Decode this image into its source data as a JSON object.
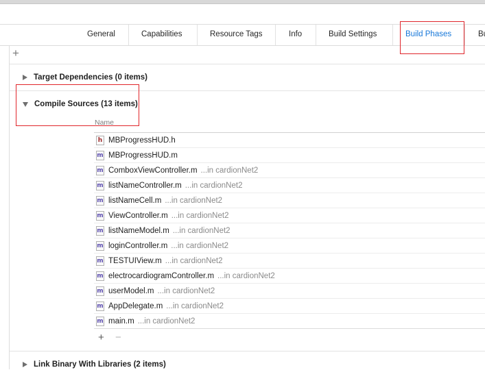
{
  "tabs": [
    {
      "label": "General",
      "active": false
    },
    {
      "label": "Capabilities",
      "active": false
    },
    {
      "label": "Resource Tags",
      "active": false
    },
    {
      "label": "Info",
      "active": false
    },
    {
      "label": "Build Settings",
      "active": false
    },
    {
      "label": "Build Phases",
      "active": true
    },
    {
      "label": "Bu",
      "active": false
    }
  ],
  "toolbar": {
    "add_label": "+"
  },
  "sections": {
    "target_dependencies": "Target Dependencies (0 items)",
    "compile_sources": "Compile Sources (13 items)",
    "link_binary": "Link Binary With Libraries (2 items)"
  },
  "table": {
    "column_name": "Name",
    "files": [
      {
        "name": "MBProgressHUD.h",
        "location": "",
        "icon": "h-file-icon",
        "badge": "h"
      },
      {
        "name": "MBProgressHUD.m",
        "location": "",
        "icon": "m-file-icon",
        "badge": "m"
      },
      {
        "name": "ComboxViewController.m",
        "location": "...in cardionNet2",
        "icon": "m-file-icon",
        "badge": "m"
      },
      {
        "name": "listNameController.m",
        "location": "...in cardionNet2",
        "icon": "m-file-icon",
        "badge": "m"
      },
      {
        "name": "listNameCell.m",
        "location": "...in cardionNet2",
        "icon": "m-file-icon",
        "badge": "m"
      },
      {
        "name": "ViewController.m",
        "location": "...in cardionNet2",
        "icon": "m-file-icon",
        "badge": "m"
      },
      {
        "name": "listNameModel.m",
        "location": "...in cardionNet2",
        "icon": "m-file-icon",
        "badge": "m"
      },
      {
        "name": "loginController.m",
        "location": "...in cardionNet2",
        "icon": "m-file-icon",
        "badge": "m"
      },
      {
        "name": "TESTUIView.m",
        "location": "...in cardionNet2",
        "icon": "m-file-icon",
        "badge": "m"
      },
      {
        "name": "electrocardiogramController.m",
        "location": "...in cardionNet2",
        "icon": "m-file-icon",
        "badge": "m"
      },
      {
        "name": "userModel.m",
        "location": "...in cardionNet2",
        "icon": "m-file-icon",
        "badge": "m"
      },
      {
        "name": "AppDelegate.m",
        "location": "...in cardionNet2",
        "icon": "m-file-icon",
        "badge": "m"
      },
      {
        "name": "main.m",
        "location": "...in cardionNet2",
        "icon": "m-file-icon",
        "badge": "m"
      }
    ],
    "add_label": "+",
    "remove_label": "−"
  },
  "colors": {
    "accent": "#1677d9",
    "highlight_box": "#e0242a"
  }
}
